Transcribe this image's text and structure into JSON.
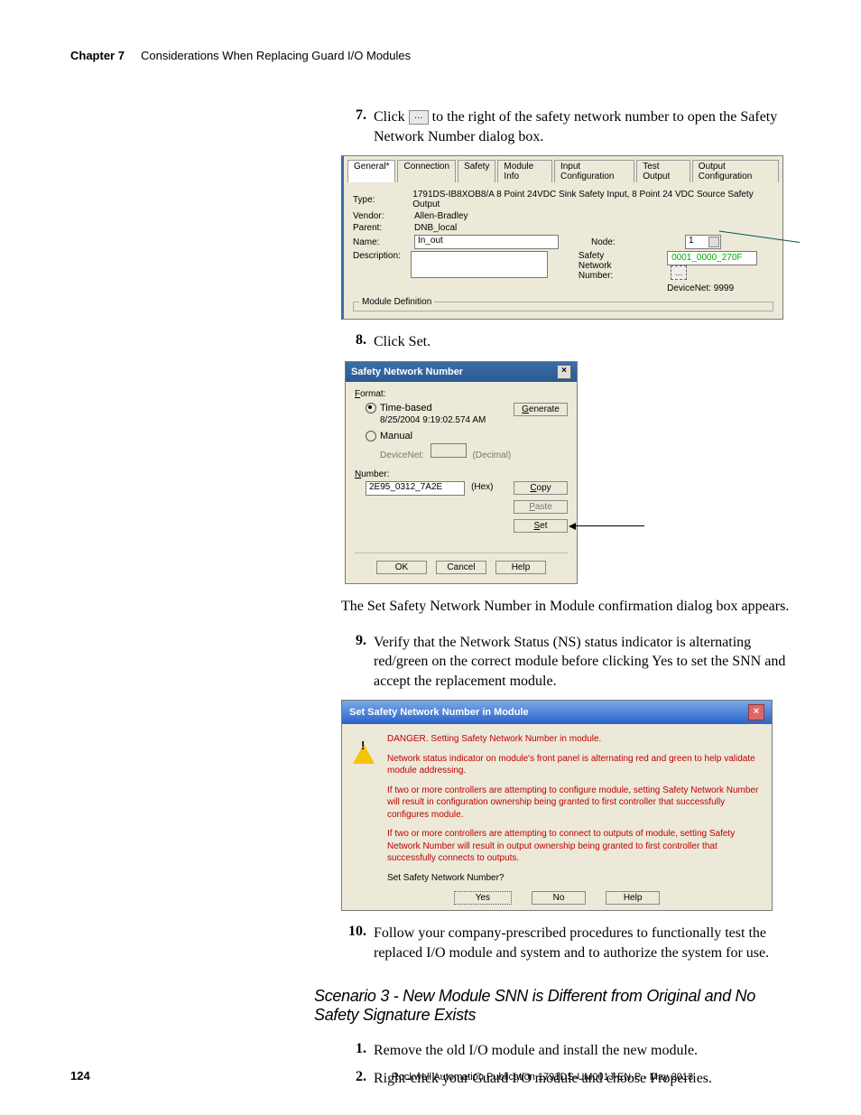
{
  "header": {
    "chapter": "Chapter 7",
    "title": "Considerations When Replacing Guard I/O Modules"
  },
  "step7": {
    "num": "7.",
    "text_a": "Click ",
    "btn": "…",
    "text_b": " to the right of the safety network number to open the Safety Network Number dialog box."
  },
  "fig1": {
    "tabs": [
      "General*",
      "Connection",
      "Safety",
      "Module Info",
      "Input Configuration",
      "Test Output",
      "Output Configuration"
    ],
    "type_l": "Type:",
    "type_v": "1791DS-IB8XOB8/A 8 Point 24VDC Sink Safety Input, 8 Point 24 VDC Source Safety Output",
    "vendor_l": "Vendor:",
    "vendor_v": "Allen-Bradley",
    "parent_l": "Parent:",
    "parent_v": "DNB_local",
    "name_l": "Name:",
    "name_v": "In_out",
    "node_l": "Node:",
    "node_v": "1",
    "desc_l": "Description:",
    "snn_l": "Safety\nNetwork Number:",
    "snn_v": "0001_0000_270F",
    "dnet": "DeviceNet: 9999",
    "moddef": "Module Definition"
  },
  "step8": {
    "num": "8.",
    "text": "Click Set."
  },
  "dlg1": {
    "title": "Safety Network Number",
    "format": "Format:",
    "opt_time": "Time-based",
    "time_val": "8/25/2004 9:19:02.574 AM",
    "opt_manual": "Manual",
    "dnet": "DeviceNet:",
    "decimal": "(Decimal)",
    "number": "Number:",
    "number_v": "2E95_0312_7A2E",
    "hex": "(Hex)",
    "gen": "Generate",
    "copy": "Copy",
    "paste": "Paste",
    "set": "Set",
    "ok": "OK",
    "cancel": "Cancel",
    "help": "Help"
  },
  "para1": "The Set Safety Network Number in Module confirmation dialog box appears.",
  "step9": {
    "num": "9.",
    "text": "Verify that the Network Status (NS) status indicator is alternating red/green on the correct module before clicking Yes to set the SNN and accept the replacement module."
  },
  "dlg2": {
    "title": "Set Safety Network Number in Module",
    "l1": "DANGER. Setting Safety Network Number in module.",
    "l2": "Network status indicator on module's front panel is alternating red and green to help validate module addressing.",
    "l3": "If two or more controllers are attempting to configure module, setting Safety Network Number will result in configuration ownership being granted to first controller that successfully configures module.",
    "l4": "If two or more controllers are attempting to connect to outputs of module, setting Safety Network Number will result in output ownership being granted to first controller that successfully connects to outputs.",
    "l5": "Set Safety Network Number?",
    "yes": "Yes",
    "no": "No",
    "help": "Help"
  },
  "step10": {
    "num": "10.",
    "text": "Follow your company-prescribed procedures to functionally test the replaced I/O module and system and to authorize the system for use."
  },
  "scenario3": "Scenario 3 - New Module SNN is Different from Original and No Safety Signature Exists",
  "s3_1": {
    "num": "1.",
    "text": "Remove the old I/O module and install the new module."
  },
  "s3_2": {
    "num": "2.",
    "text": "Right-click your Guard I/O module and choose Properties."
  },
  "footer": {
    "page": "124",
    "pub": "Rockwell Automation Publication 1791DS-UM001J-EN-P - May 2013"
  }
}
